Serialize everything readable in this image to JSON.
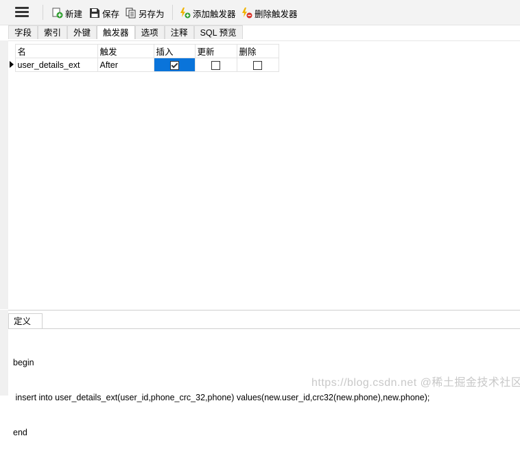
{
  "toolbar": {
    "new_label": "新建",
    "save_label": "保存",
    "save_as_label": "另存为",
    "add_trigger_label": "添加触发器",
    "delete_trigger_label": "删除触发器"
  },
  "tabs": [
    {
      "label": "字段"
    },
    {
      "label": "索引"
    },
    {
      "label": "外键"
    },
    {
      "label": "触发器"
    },
    {
      "label": "选项"
    },
    {
      "label": "注释"
    },
    {
      "label": "SQL 预览"
    }
  ],
  "grid": {
    "columns": [
      "名",
      "触发",
      "插入",
      "更新",
      "删除"
    ],
    "rows": [
      {
        "name": "user_details_ext",
        "timing": "After",
        "insert": true,
        "update": false,
        "delete": false
      }
    ]
  },
  "definition": {
    "tab_label": "定义",
    "code": [
      "begin",
      " insert into user_details_ext(user_id,phone_crc_32,phone) values(new.user_id,crc32(new.phone),new.phone);",
      "end"
    ]
  },
  "watermark": "https://blog.csdn.net @稀土掘金技术社区",
  "colors": {
    "selection": "#0a74da",
    "add_icon": "#2e9e2e",
    "delete_icon": "#d93025",
    "bolt": "#f0b400"
  }
}
